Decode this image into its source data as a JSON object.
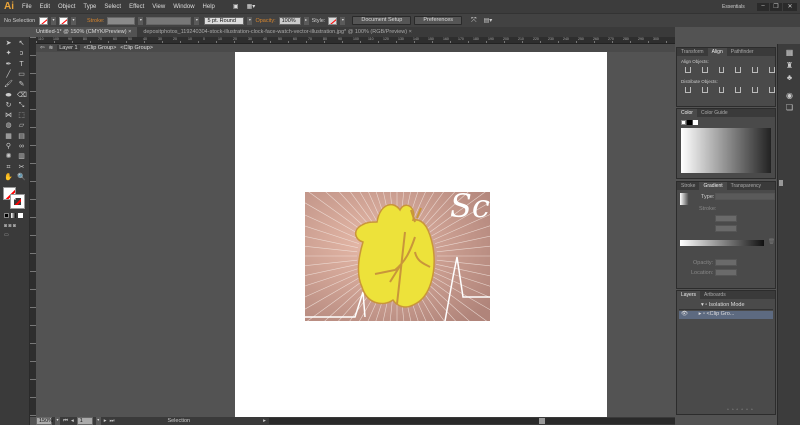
{
  "app": {
    "logo": "Ai",
    "workspace": "Essentials"
  },
  "menu": [
    "File",
    "Edit",
    "Object",
    "Type",
    "Select",
    "Effect",
    "View",
    "Window",
    "Help"
  ],
  "control": {
    "selection": "No Selection",
    "stroke_label": "Stroke:",
    "brush": "5 pt. Round",
    "opacity_label": "Opacity:",
    "opacity": "100%",
    "style_label": "Style:",
    "document_setup": "Document Setup",
    "preferences": "Preferences"
  },
  "tabs": [
    {
      "label": "Untitled-1* @ 150% (CMYK/Preview)",
      "active": true
    },
    {
      "label": "depositphotos_119240304-stock-illustration-clock-face-watch-vector-illustration.jpg* @ 100% (RGB/Preview)",
      "active": false
    }
  ],
  "ruler": [
    "110",
    "100",
    "90",
    "80",
    "70",
    "60",
    "50",
    "40",
    "30",
    "20",
    "10",
    "0",
    "10",
    "20",
    "30",
    "40",
    "50",
    "60",
    "70",
    "80",
    "90",
    "100",
    "110",
    "120",
    "130",
    "140",
    "150",
    "160",
    "170",
    "180",
    "190",
    "200",
    "210",
    "220",
    "230",
    "240",
    "250",
    "260",
    "270",
    "280",
    "290",
    "300"
  ],
  "breadcrumb": [
    "Layer 1",
    "<Clip Group>",
    "<Clip Group>"
  ],
  "status": {
    "zoom": "150%",
    "page": "1",
    "tool": "Selection"
  },
  "panels": {
    "align": {
      "tabs": [
        "Transform",
        "Align",
        "Pathfinder"
      ],
      "active": "Align",
      "align_objects": "Align Objects:",
      "distribute_objects": "Distribute Objects:"
    },
    "color": {
      "tabs": [
        "Color",
        "Color Guide"
      ],
      "active": "Color"
    },
    "gradient": {
      "tabs": [
        "Stroke",
        "Gradient",
        "Transparency"
      ],
      "active": "Gradient",
      "type": "Type:",
      "stroke": "Stroke:",
      "opacity": "Opacity:",
      "location": "Location:"
    },
    "layers": {
      "tabs": [
        "Layers",
        "Artboards"
      ],
      "active": "Layers",
      "rows": [
        "Isolation Mode",
        "<Clip Gro..."
      ]
    }
  },
  "colors": {
    "heart": "#ede23a",
    "heart_outline": "#c9963a",
    "background": "#c99a8e",
    "ui_dark": "#3c3c3c",
    "canvas": "#535353"
  }
}
